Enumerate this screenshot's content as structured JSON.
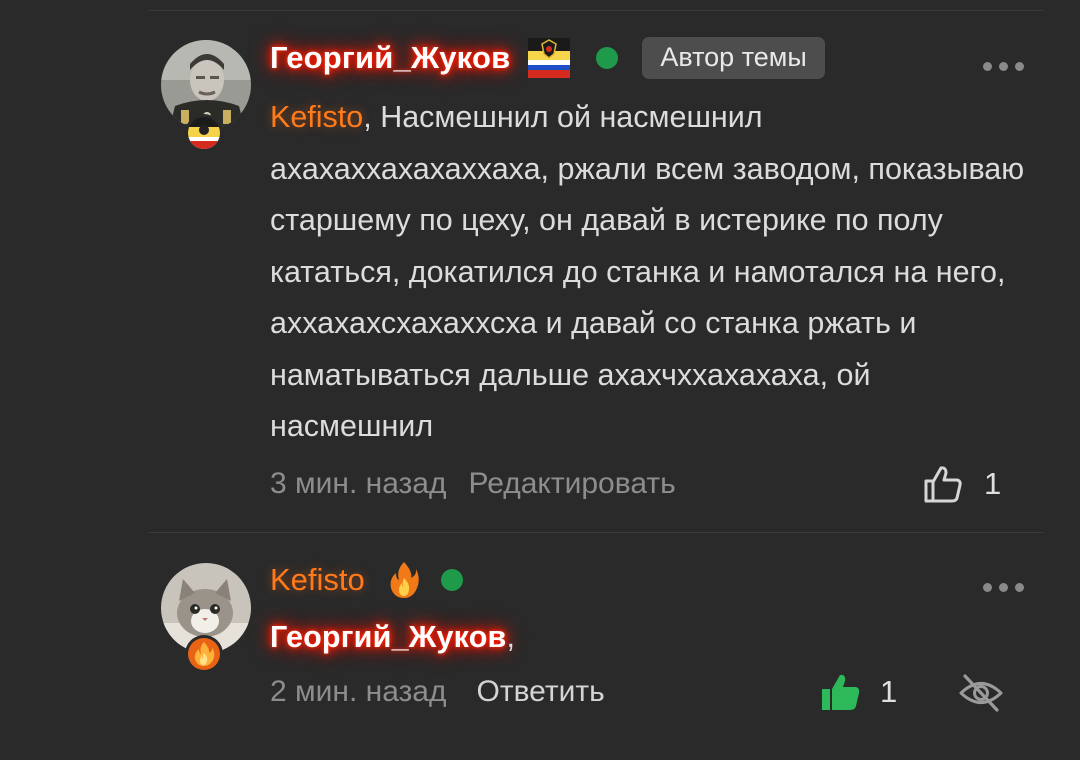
{
  "comments": [
    {
      "author": "Георгий_Жуков",
      "author_badge": "Автор темы",
      "mention": "Kefisto",
      "text": ", Насмешнил ой насмешнил ахахаххахахаххаха, ржали всем заводом, показываю старшему по цеху, он давай в истерике по полу кататься, докатился до станка и намотался на него, аххахахсхахаххсха и давай со станка ржать и наматываться дальше ахахчххахахаха, ой насмешнил",
      "time": "3 мин. назад",
      "action": "Редактировать",
      "likes": "1",
      "online_color": "#1e9a4a",
      "name_glow_color": "#ff1800"
    },
    {
      "author": "Kefisto",
      "mention": "Георгий_Жуков",
      "text": ",",
      "time": "2 мин. назад",
      "action": "Ответить",
      "likes": "1",
      "like_color": "#2db85a",
      "online_color": "#1e9a4a"
    }
  ],
  "colors": {
    "background": "#2a2a2a",
    "mention_orange": "#ff7a1a",
    "muted": "#8d8d8d"
  }
}
